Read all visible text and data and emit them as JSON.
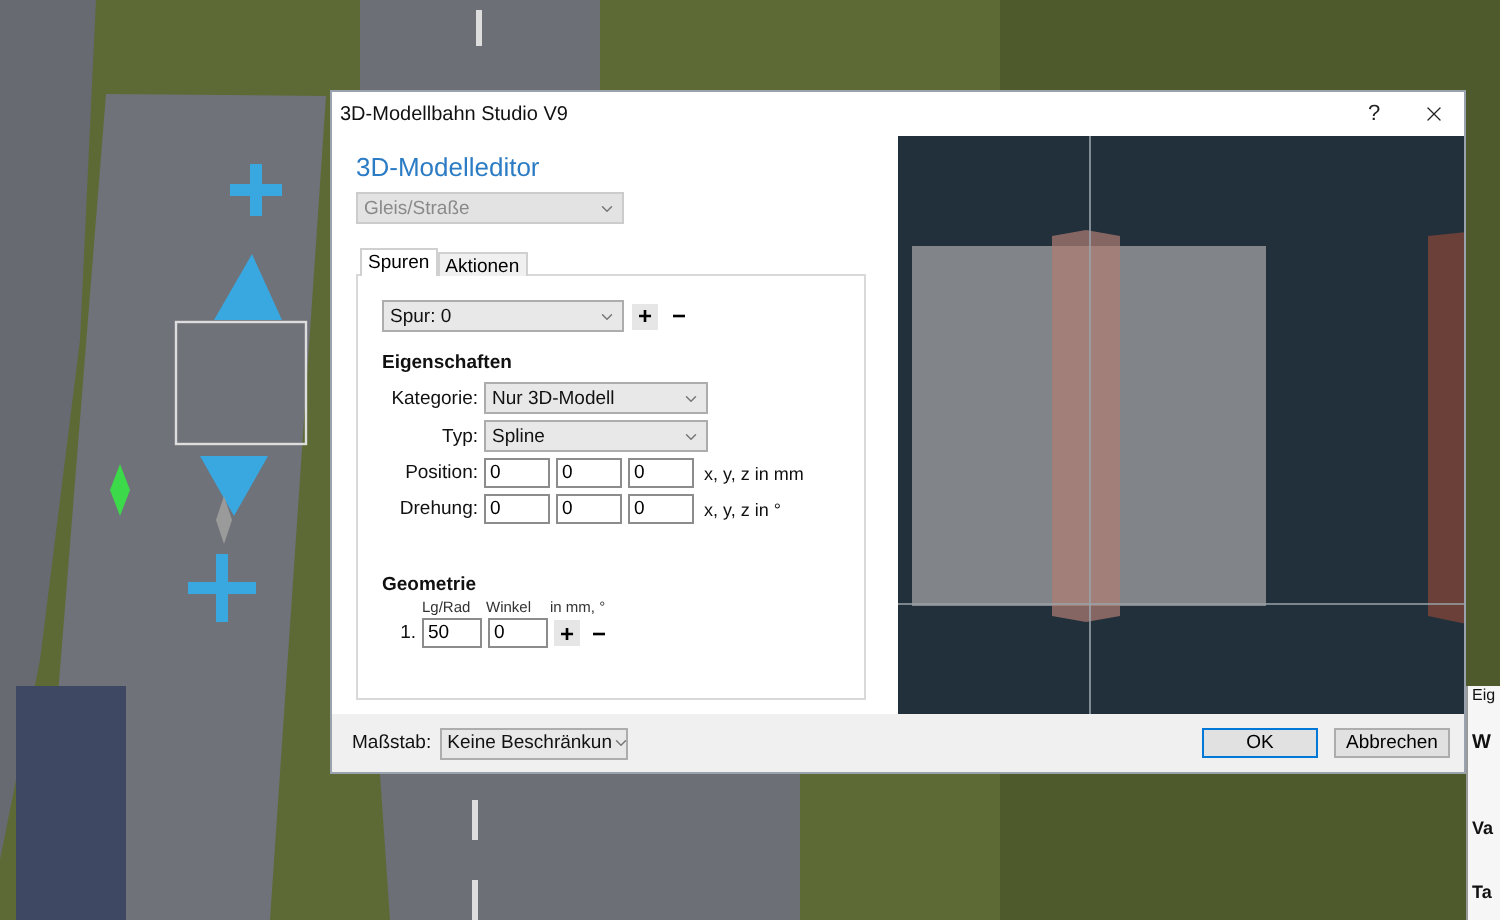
{
  "window": {
    "title": "3D-Modellbahn Studio V9",
    "help": "?"
  },
  "editor": {
    "heading": "3D-Modelleditor",
    "type_select": {
      "value": "Gleis/Straße",
      "disabled": true
    },
    "tabs": [
      {
        "label": "Spuren",
        "selected": true
      },
      {
        "label": "Aktionen",
        "selected": false
      }
    ],
    "track_select": {
      "value": "Spur: 0"
    },
    "track_buttons": [
      "+",
      "−"
    ],
    "properties": {
      "title": "Eigenschaften",
      "rows": [
        {
          "kind": "select",
          "label": "Kategorie:",
          "value": "Nur 3D-Modell"
        },
        {
          "kind": "select",
          "label": "Typ:",
          "value": "Spline"
        },
        {
          "kind": "vector",
          "label": "Position:",
          "values": [
            "0",
            "0",
            "0"
          ],
          "unit": "x, y, z in mm"
        },
        {
          "kind": "vector",
          "label": "Drehung:",
          "values": [
            "0",
            "0",
            "0"
          ],
          "unit": "x, y, z in °"
        }
      ]
    },
    "geometry": {
      "title": "Geometrie",
      "columns": [
        "Lg/Rad",
        "Winkel",
        "in mm, °"
      ],
      "rows": [
        {
          "index": "1.",
          "values": [
            "50",
            "0"
          ],
          "buttons": [
            "+",
            "−"
          ]
        }
      ]
    }
  },
  "footer": {
    "scale_label": "Maßstab:",
    "scale_value": "Keine Beschränkun",
    "buttons": [
      {
        "label": "OK",
        "default": true
      },
      {
        "label": "Abbrechen",
        "default": false
      }
    ]
  },
  "side_window": {
    "title": "Eig",
    "heading": "W",
    "labels": [
      "Va",
      "Ta"
    ]
  }
}
